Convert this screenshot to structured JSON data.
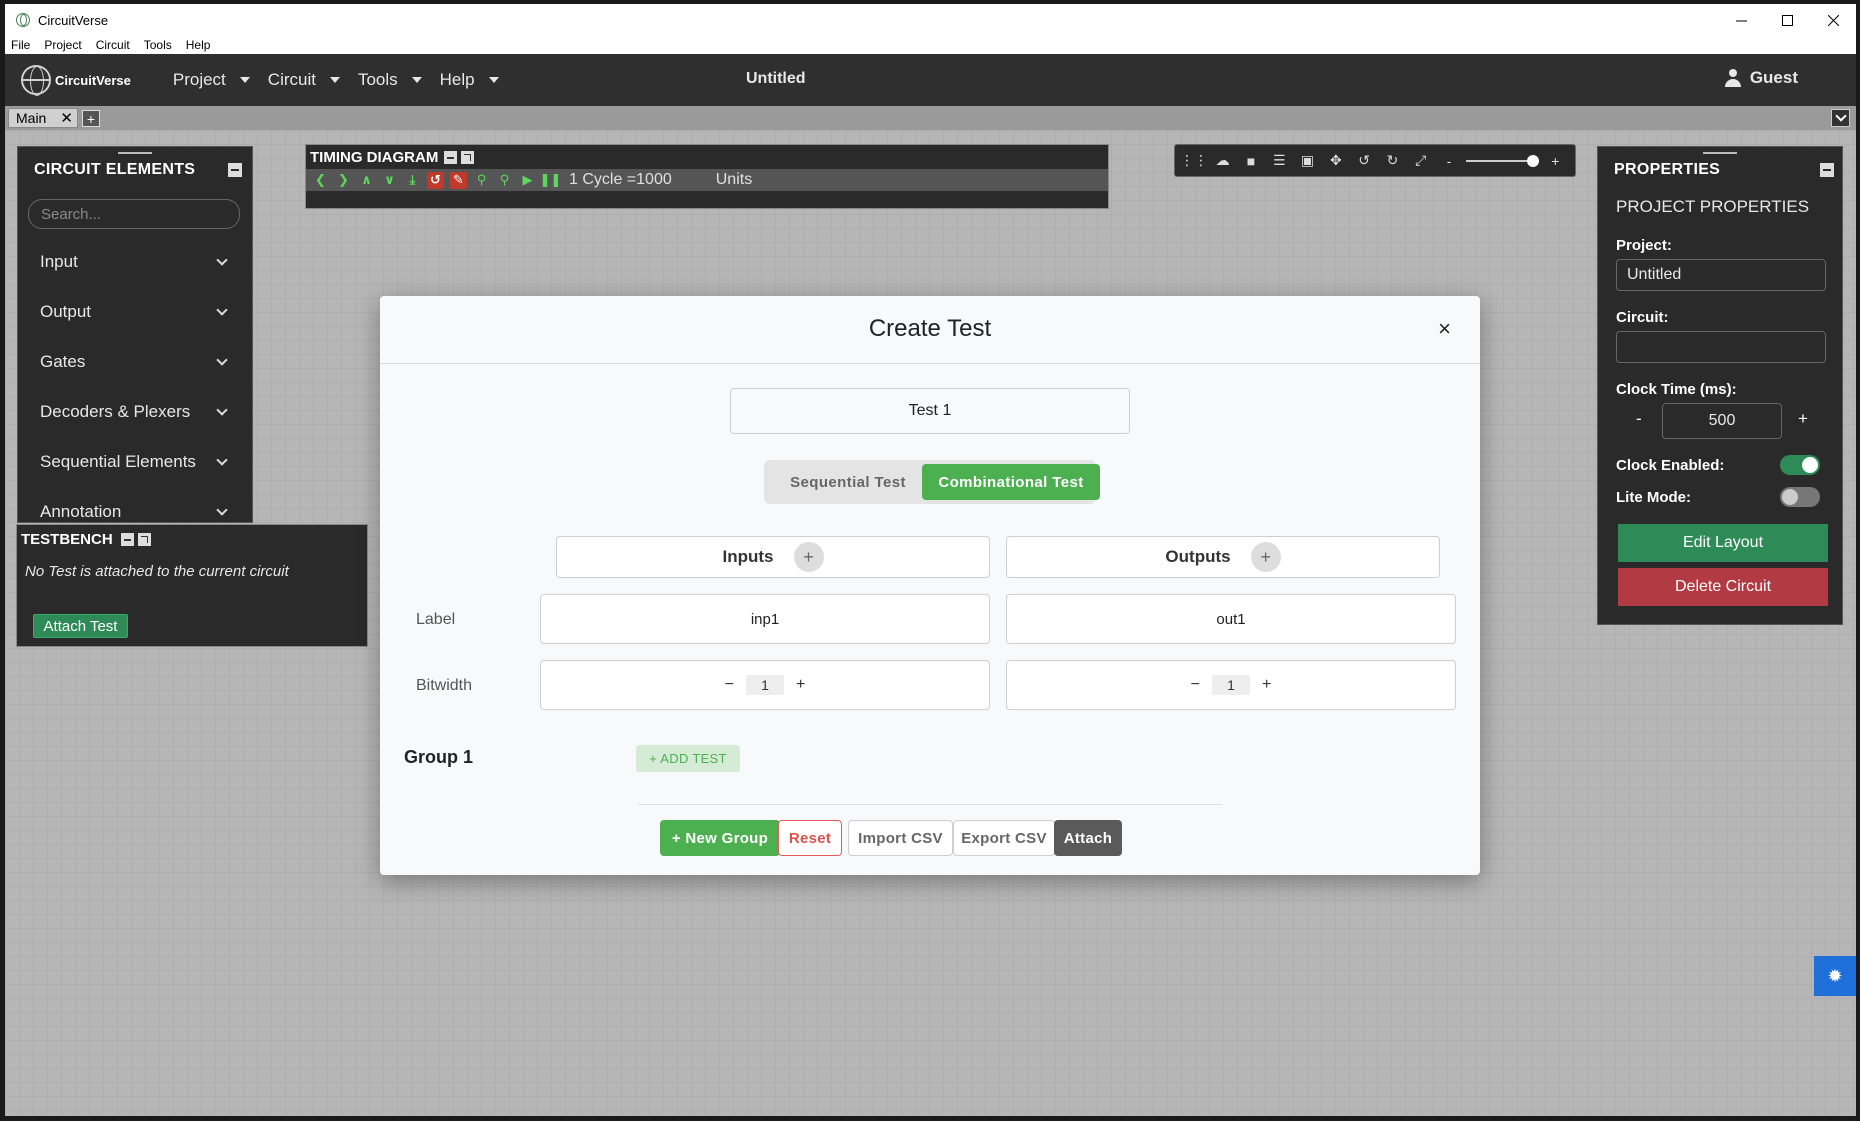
{
  "window": {
    "title": "CircuitVerse",
    "menu": [
      "File",
      "Project",
      "Circuit",
      "Tools",
      "Help"
    ]
  },
  "navbar": {
    "logo": "CircuitVerse",
    "menu": [
      "Project",
      "Circuit",
      "Tools",
      "Help"
    ],
    "project_title": "Untitled",
    "user": "Guest"
  },
  "tabs": {
    "main": "Main",
    "close": "✕",
    "add": "+"
  },
  "circuit_elements": {
    "title": "CIRCUIT ELEMENTS",
    "search_placeholder": "Search...",
    "items": [
      "Input",
      "Output",
      "Gates",
      "Decoders & Plexers",
      "Sequential Elements",
      "Annotation"
    ]
  },
  "testbench": {
    "title": "TESTBENCH",
    "message": "No Test is attached to the current circuit",
    "attach_label": "Attach Test"
  },
  "timing_diagram": {
    "title": "TIMING DIAGRAM",
    "cycle_text": "1 Cycle =1000",
    "units": "Units"
  },
  "properties": {
    "title": "PROPERTIES",
    "subtitle": "PROJECT PROPERTIES",
    "project_label": "Project:",
    "project_value": "Untitled",
    "circuit_label": "Circuit:",
    "circuit_value": "",
    "clock_time_label": "Clock Time (ms):",
    "clock_minus": "-",
    "clock_value": "500",
    "clock_plus": "+",
    "clock_enabled_label": "Clock Enabled:",
    "clock_enabled": true,
    "lite_mode_label": "Lite Mode:",
    "lite_mode": false,
    "edit_layout_label": "Edit Layout",
    "delete_circuit_label": "Delete Circuit"
  },
  "modal": {
    "title": "Create Test",
    "close": "×",
    "test_name": "Test 1",
    "sequential_label": "Sequential Test",
    "combinational_label": "Combinational Test",
    "inputs_label": "Inputs",
    "outputs_label": "Outputs",
    "plus": "+",
    "label_row": "Label",
    "bitwidth_row": "Bitwidth",
    "input_label_value": "inp1",
    "output_label_value": "out1",
    "minus": "−",
    "input_bitwidth": "1",
    "output_bitwidth": "1",
    "group_label": "Group 1",
    "add_test_label": "+ ADD TEST",
    "new_group_label": "+ New Group",
    "reset_label": "Reset",
    "import_label": "Import CSV",
    "export_label": "Export CSV",
    "attach_label": "Attach"
  },
  "colors": {
    "accent_green": "#4caf50",
    "panel_dark": "#2a2a2a",
    "danger": "#b23b43",
    "edit_green": "#2e8b57"
  }
}
